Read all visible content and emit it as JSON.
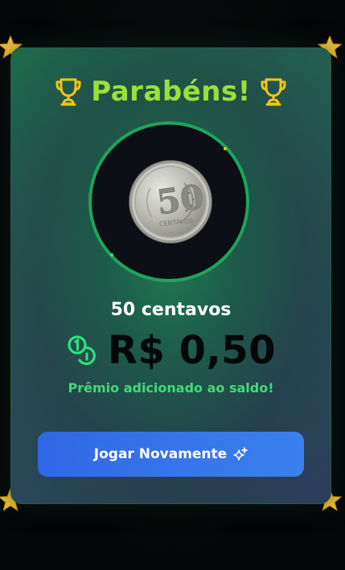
{
  "modal": {
    "title": "Parabéns!",
    "coin_name": "50 centavos",
    "amount": "R$ 0,50",
    "message": "Prêmio adicionado ao saldo!",
    "button_label": "Jogar Novamente"
  },
  "icons": {
    "title_left": "trophy-icon",
    "title_right": "trophy-icon",
    "amount": "coins-icon",
    "button": "sparkles-icon",
    "corners": "star-icon"
  },
  "colors": {
    "title": "#9be03a",
    "trophy": "#f5c518",
    "ring": "#1fa45c",
    "message": "#3ddc7a",
    "button": "#3374ea",
    "star": "#f7c531"
  }
}
